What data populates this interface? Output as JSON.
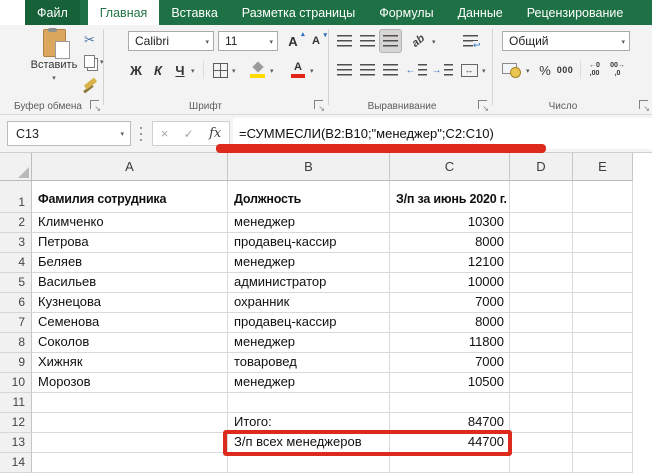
{
  "tab_bar": {
    "items": [
      {
        "label": "Файл",
        "type": "file",
        "active": false
      },
      {
        "label": "Главная",
        "active": true
      },
      {
        "label": "Вставка",
        "active": false
      },
      {
        "label": "Разметка страницы",
        "active": false
      },
      {
        "label": "Формулы",
        "active": false
      },
      {
        "label": "Данные",
        "active": false
      },
      {
        "label": "Рецензирование",
        "active": false
      }
    ]
  },
  "ribbon": {
    "clipboard": {
      "label": "Буфер обмена",
      "paste": "Вставить"
    },
    "font": {
      "label": "Шрифт",
      "name": "Calibri",
      "size": "11",
      "bold": "Ж",
      "italic": "К",
      "underline": "Ч",
      "grow": "А",
      "shrink": "А",
      "color_letter": "А"
    },
    "alignment": {
      "label": "Выравнивание",
      "orientation": "ab"
    },
    "number": {
      "label": "Число",
      "format": "Общий",
      "percent": "%",
      "thousands": "000",
      "inc_top": "←0",
      "inc_bot": ",00",
      "dec_top": "00→",
      "dec_bot": ",0"
    }
  },
  "formula_bar": {
    "cell_ref": "C13",
    "cancel": "×",
    "enter": "✓",
    "fx": "fx",
    "formula": "=СУММЕСЛИ(B2:B10;\"менеджер\";C2:C10)"
  },
  "grid": {
    "column_headers": [
      "A",
      "B",
      "C",
      "D",
      "E"
    ],
    "rows": [
      {
        "n": "1",
        "a": "Фамилия сотрудника",
        "b": "Должность",
        "c": "З/п за июнь 2020 г.",
        "bold": true
      },
      {
        "n": "2",
        "a": "Климченко",
        "b": "менеджер",
        "c": "10300"
      },
      {
        "n": "3",
        "a": "Петрова",
        "b": "продавец-кассир",
        "c": "8000"
      },
      {
        "n": "4",
        "a": "Беляев",
        "b": "менеджер",
        "c": "12100"
      },
      {
        "n": "5",
        "a": "Васильев",
        "b": "администратор",
        "c": "10000"
      },
      {
        "n": "6",
        "a": "Кузнецова",
        "b": "охранник",
        "c": "7000"
      },
      {
        "n": "7",
        "a": "Семенова",
        "b": "продавец-кассир",
        "c": "8000"
      },
      {
        "n": "8",
        "a": "Соколов",
        "b": "менеджер",
        "c": "11800"
      },
      {
        "n": "9",
        "a": "Хижняк",
        "b": "товаровед",
        "c": "7000"
      },
      {
        "n": "10",
        "a": "Морозов",
        "b": "менеджер",
        "c": "10500"
      },
      {
        "n": "11",
        "a": "",
        "b": "",
        "c": ""
      },
      {
        "n": "12",
        "a": "",
        "b": "Итого:",
        "c": "84700"
      },
      {
        "n": "13",
        "a": "",
        "b": "З/п всех менеджеров",
        "c": "44700",
        "annotated": true
      },
      {
        "n": "14",
        "a": "",
        "b": "",
        "c": ""
      }
    ]
  },
  "annotations": {
    "formula_underlined": true,
    "boxed_cells": "B13:C13",
    "color": "#dd2a1c"
  },
  "colors": {
    "excel_green": "#1e7145",
    "active_tab_text": "#217346",
    "annotation_red": "#dd2a1c",
    "fill_yellow": "#ffdb00",
    "font_color_red": "#e02417"
  },
  "icons": {
    "cut": "✂",
    "copy": "copy-pages",
    "paste": "clipboard",
    "format_painter": "brush",
    "borders": "grid-square",
    "fill_color": "bucket-yellow",
    "font_color": "letter-red-bar",
    "wrap_arrow": "↩",
    "merge_arrow": "↔",
    "dropdown": "▾",
    "dialog_launcher": "↘",
    "grow_arrow": "▴",
    "shrink_arrow": "▾",
    "currency": "coin-banknote"
  }
}
